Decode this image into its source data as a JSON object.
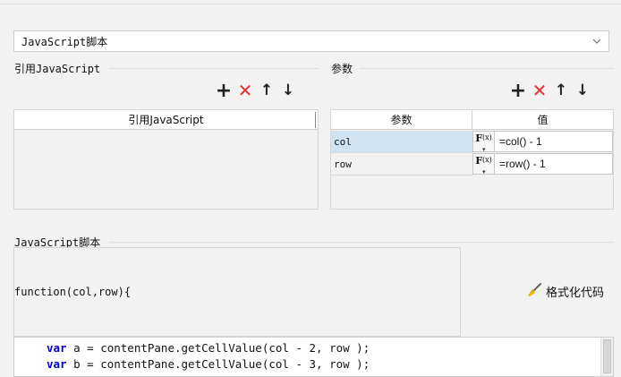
{
  "dropdown": {
    "selected": "JavaScript脚本"
  },
  "ref_section": {
    "title": "引用JavaScript",
    "column_header": "引用JavaScript"
  },
  "params_section": {
    "title": "参数",
    "col_name": "参数",
    "col_value": "值",
    "rows": [
      {
        "name": "col",
        "value": "=col() - 1",
        "selected": true
      },
      {
        "name": "row",
        "value": "=row() - 1",
        "selected": false
      }
    ]
  },
  "toolbar": {
    "add": "+",
    "delete": "✕",
    "up": "↑",
    "down": "↓"
  },
  "fx_label": {
    "f": "F",
    "x": "(x)"
  },
  "script_section": {
    "title": "JavaScript脚本",
    "signature": "function(col,row){",
    "format_button": "格式化代码",
    "code_lines": [
      {
        "kw": "var",
        "rest": " a = contentPane.getCellValue(col - 2, row );"
      },
      {
        "kw": "var",
        "rest": " b = contentPane.getCellValue(col - 3, row );"
      }
    ]
  },
  "colors": {
    "selected_row": "#cfe3f2",
    "delete_red": "#e5322d",
    "keyword_blue": "#0000d0",
    "brush_yellow": "#f2b90f"
  }
}
